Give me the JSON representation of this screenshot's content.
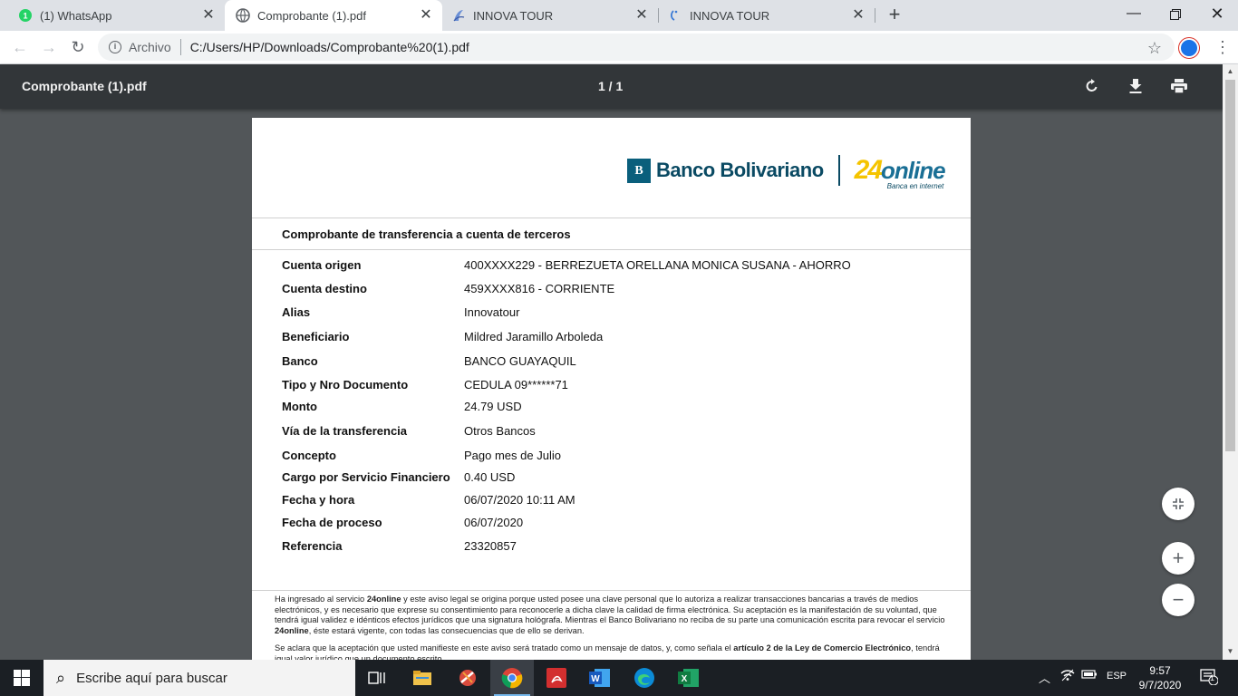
{
  "browser": {
    "tabs": [
      {
        "title": "(1) WhatsApp",
        "icon": "whatsapp-icon",
        "active": false
      },
      {
        "title": "Comprobante (1).pdf",
        "icon": "globe-icon",
        "active": true
      },
      {
        "title": "INNOVA TOUR",
        "icon": "innova-icon",
        "active": false
      },
      {
        "title": "INNOVA TOUR",
        "icon": "innova-icon",
        "active": false
      }
    ],
    "new_tab_label": "+",
    "address": {
      "scheme_label": "Archivo",
      "url": "C:/Users/HP/Downloads/Comprobante%20(1).pdf"
    }
  },
  "pdf_viewer": {
    "title": "Comprobante (1).pdf",
    "page_counter": "1 / 1"
  },
  "document": {
    "bank_name": "Banco Bolivariano",
    "bank_mark": "B",
    "brand_24": "24",
    "brand_online": "online",
    "brand_tagline": "Banca en internet",
    "heading": "Comprobante de transferencia a cuenta de terceros",
    "rows": [
      {
        "label": "Cuenta origen",
        "value": "400XXXX229 - BERREZUETA ORELLANA MONICA SUSANA - AHORRO"
      },
      {
        "label": "Cuenta destino",
        "value": "459XXXX816 - CORRIENTE"
      },
      {
        "label": "Alias",
        "value": "Innovatour"
      },
      {
        "label": "Beneficiario",
        "value": "Mildred Jaramillo Arboleda"
      },
      {
        "label": "Banco",
        "value": "BANCO GUAYAQUIL"
      },
      {
        "label": "Tipo y Nro Documento",
        "value": "CEDULA 09******71"
      },
      {
        "label": "Monto",
        "value": "24.79 USD"
      },
      {
        "label": "Vía de la transferencia",
        "value": "Otros Bancos"
      },
      {
        "label": "Concepto",
        "value": "Pago mes de Julio"
      },
      {
        "label": "Cargo por Servicio Financiero",
        "value": "0.40 USD"
      },
      {
        "label": "Fecha y hora",
        "value": "06/07/2020 10:11 AM"
      },
      {
        "label": "Fecha de proceso",
        "value": "06/07/2020"
      },
      {
        "label": "Referencia",
        "value": "23320857"
      }
    ],
    "legal_1": {
      "p1": "Ha ingresado al servicio ",
      "b1": "24online",
      "p2": " y este aviso legal se origina porque usted posee una clave personal que lo autoriza a realizar transacciones bancarias a través de medios electrónicos, y es necesario que exprese su consentimiento para reconocerle a dicha clave la calidad de firma electrónica. Su aceptación es la manifestación de su voluntad, que tendrá igual validez e idénticos efectos jurídicos que una signatura hológrafa. Mientras el Banco Bolivariano no reciba de su parte una comunicación escrita para revocar el servicio ",
      "b2": "24online",
      "p3": ", éste estará vigente, con todas las consecuencias que de ello se derivan."
    },
    "legal_2": {
      "p1": "Se aclara que la aceptación que usted manifieste en este aviso será tratado como un mensaje de datos, y, como señala el ",
      "b1": "artículo 2 de la Ley de Comercio Electrónico",
      "p2": ", tendrá igual valor jurídico que un documento escrito."
    }
  },
  "taskbar": {
    "search_placeholder": "Escribe aquí para buscar",
    "language": "ESP",
    "time": "9:57",
    "date": "9/7/2020",
    "notification_count": "1"
  }
}
